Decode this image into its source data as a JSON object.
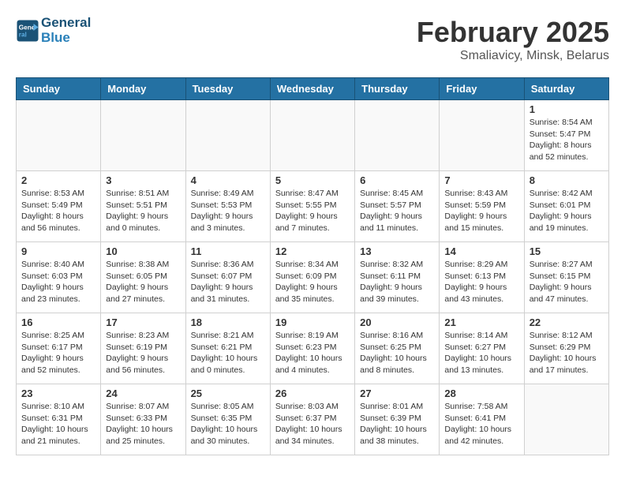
{
  "header": {
    "logo_line1": "General",
    "logo_line2": "Blue",
    "month_title": "February 2025",
    "location": "Smaliavicy, Minsk, Belarus"
  },
  "weekdays": [
    "Sunday",
    "Monday",
    "Tuesday",
    "Wednesday",
    "Thursday",
    "Friday",
    "Saturday"
  ],
  "weeks": [
    [
      {
        "day": "",
        "info": ""
      },
      {
        "day": "",
        "info": ""
      },
      {
        "day": "",
        "info": ""
      },
      {
        "day": "",
        "info": ""
      },
      {
        "day": "",
        "info": ""
      },
      {
        "day": "",
        "info": ""
      },
      {
        "day": "1",
        "info": "Sunrise: 8:54 AM\nSunset: 5:47 PM\nDaylight: 8 hours and 52 minutes."
      }
    ],
    [
      {
        "day": "2",
        "info": "Sunrise: 8:53 AM\nSunset: 5:49 PM\nDaylight: 8 hours and 56 minutes."
      },
      {
        "day": "3",
        "info": "Sunrise: 8:51 AM\nSunset: 5:51 PM\nDaylight: 9 hours and 0 minutes."
      },
      {
        "day": "4",
        "info": "Sunrise: 8:49 AM\nSunset: 5:53 PM\nDaylight: 9 hours and 3 minutes."
      },
      {
        "day": "5",
        "info": "Sunrise: 8:47 AM\nSunset: 5:55 PM\nDaylight: 9 hours and 7 minutes."
      },
      {
        "day": "6",
        "info": "Sunrise: 8:45 AM\nSunset: 5:57 PM\nDaylight: 9 hours and 11 minutes."
      },
      {
        "day": "7",
        "info": "Sunrise: 8:43 AM\nSunset: 5:59 PM\nDaylight: 9 hours and 15 minutes."
      },
      {
        "day": "8",
        "info": "Sunrise: 8:42 AM\nSunset: 6:01 PM\nDaylight: 9 hours and 19 minutes."
      }
    ],
    [
      {
        "day": "9",
        "info": "Sunrise: 8:40 AM\nSunset: 6:03 PM\nDaylight: 9 hours and 23 minutes."
      },
      {
        "day": "10",
        "info": "Sunrise: 8:38 AM\nSunset: 6:05 PM\nDaylight: 9 hours and 27 minutes."
      },
      {
        "day": "11",
        "info": "Sunrise: 8:36 AM\nSunset: 6:07 PM\nDaylight: 9 hours and 31 minutes."
      },
      {
        "day": "12",
        "info": "Sunrise: 8:34 AM\nSunset: 6:09 PM\nDaylight: 9 hours and 35 minutes."
      },
      {
        "day": "13",
        "info": "Sunrise: 8:32 AM\nSunset: 6:11 PM\nDaylight: 9 hours and 39 minutes."
      },
      {
        "day": "14",
        "info": "Sunrise: 8:29 AM\nSunset: 6:13 PM\nDaylight: 9 hours and 43 minutes."
      },
      {
        "day": "15",
        "info": "Sunrise: 8:27 AM\nSunset: 6:15 PM\nDaylight: 9 hours and 47 minutes."
      }
    ],
    [
      {
        "day": "16",
        "info": "Sunrise: 8:25 AM\nSunset: 6:17 PM\nDaylight: 9 hours and 52 minutes."
      },
      {
        "day": "17",
        "info": "Sunrise: 8:23 AM\nSunset: 6:19 PM\nDaylight: 9 hours and 56 minutes."
      },
      {
        "day": "18",
        "info": "Sunrise: 8:21 AM\nSunset: 6:21 PM\nDaylight: 10 hours and 0 minutes."
      },
      {
        "day": "19",
        "info": "Sunrise: 8:19 AM\nSunset: 6:23 PM\nDaylight: 10 hours and 4 minutes."
      },
      {
        "day": "20",
        "info": "Sunrise: 8:16 AM\nSunset: 6:25 PM\nDaylight: 10 hours and 8 minutes."
      },
      {
        "day": "21",
        "info": "Sunrise: 8:14 AM\nSunset: 6:27 PM\nDaylight: 10 hours and 13 minutes."
      },
      {
        "day": "22",
        "info": "Sunrise: 8:12 AM\nSunset: 6:29 PM\nDaylight: 10 hours and 17 minutes."
      }
    ],
    [
      {
        "day": "23",
        "info": "Sunrise: 8:10 AM\nSunset: 6:31 PM\nDaylight: 10 hours and 21 minutes."
      },
      {
        "day": "24",
        "info": "Sunrise: 8:07 AM\nSunset: 6:33 PM\nDaylight: 10 hours and 25 minutes."
      },
      {
        "day": "25",
        "info": "Sunrise: 8:05 AM\nSunset: 6:35 PM\nDaylight: 10 hours and 30 minutes."
      },
      {
        "day": "26",
        "info": "Sunrise: 8:03 AM\nSunset: 6:37 PM\nDaylight: 10 hours and 34 minutes."
      },
      {
        "day": "27",
        "info": "Sunrise: 8:01 AM\nSunset: 6:39 PM\nDaylight: 10 hours and 38 minutes."
      },
      {
        "day": "28",
        "info": "Sunrise: 7:58 AM\nSunset: 6:41 PM\nDaylight: 10 hours and 42 minutes."
      },
      {
        "day": "",
        "info": ""
      }
    ]
  ]
}
